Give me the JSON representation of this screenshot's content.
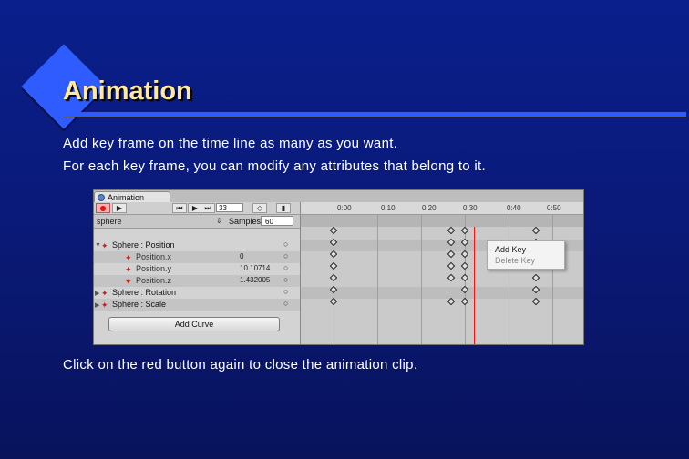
{
  "slide": {
    "title": "Animation",
    "lines": [
      "Add key frame on the time line as many as you want.",
      "For each key frame, you can modify any attributes that belong to it.",
      "Click on the red button again to close the animation clip."
    ]
  },
  "animation_window": {
    "tab_label": "Animation",
    "tab_icon": "animation-icon",
    "toolbar": {
      "frame_value": "33",
      "buttons": [
        "record",
        "previous-keyframe",
        "play",
        "next-keyframe",
        "add-keyframe",
        "add-event"
      ]
    },
    "ruler_labels": [
      "0:00",
      "0:10",
      "0:20",
      "0:30",
      "0:40",
      "0:50"
    ],
    "clip": {
      "name": "sphere",
      "samples_label": "Samples",
      "samples_value": "60"
    },
    "properties": [
      {
        "label": "Sphere : Position",
        "value": "",
        "curve": "○",
        "indent": 0,
        "expanded": true
      },
      {
        "label": "Position.x",
        "value": "0",
        "curve": "○",
        "indent": 1
      },
      {
        "label": "Position.y",
        "value": "10.10714",
        "curve": "○",
        "indent": 1
      },
      {
        "label": "Position.z",
        "value": "1.432005",
        "curve": "○",
        "indent": 1
      },
      {
        "label": "Sphere : Rotation",
        "value": "",
        "curve": "○",
        "indent": 0,
        "expanded": false
      },
      {
        "label": "Sphere : Scale",
        "value": "",
        "curve": "○",
        "indent": 0,
        "expanded": false
      }
    ],
    "add_curve_label": "Add Curve",
    "context_menu": {
      "items": [
        "Add Key",
        "Delete Key"
      ]
    },
    "colors": {
      "record": "#e01010",
      "playhead": "#ff1010"
    }
  }
}
